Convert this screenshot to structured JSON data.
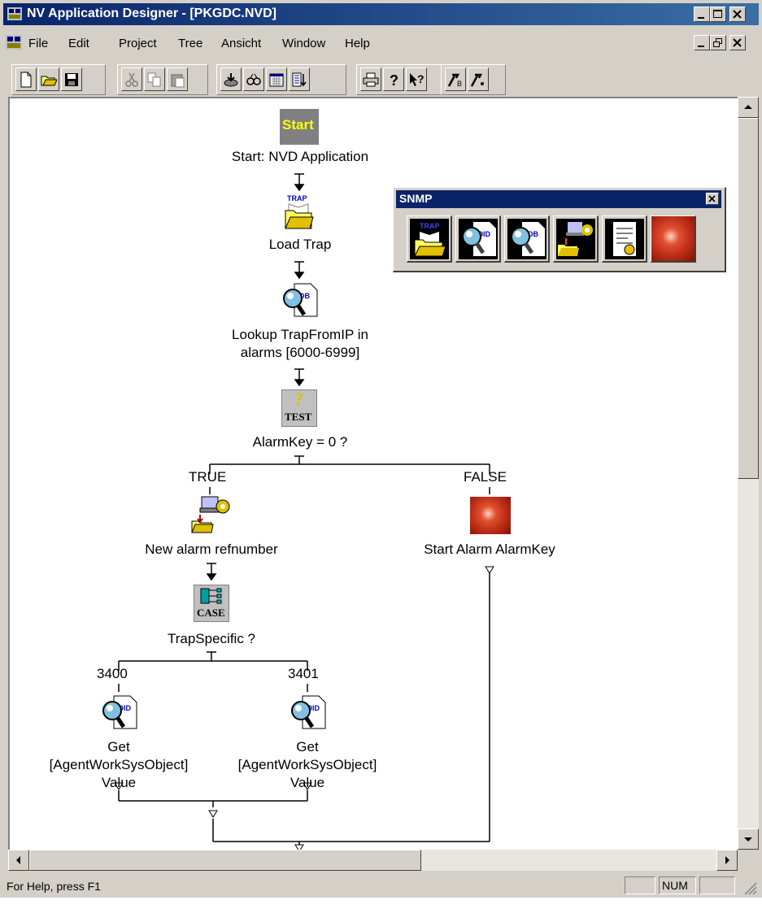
{
  "window": {
    "title": "NV Application Designer - [PKGDC.NVD]"
  },
  "menu": {
    "items": [
      {
        "label": "File"
      },
      {
        "label": "Edit"
      },
      {
        "label": "Project"
      },
      {
        "label": "Tree"
      },
      {
        "label": "Ansicht"
      },
      {
        "label": "Window"
      },
      {
        "label": "Help"
      }
    ]
  },
  "toolbar": {
    "buttons": [
      "new-icon",
      "open-icon",
      "save-icon",
      "cut-icon",
      "copy-icon",
      "paste-icon",
      "import-icon",
      "find-icon",
      "calendar-icon",
      "sort-icon",
      "print-icon",
      "help-icon",
      "context-help-icon",
      "build-icon",
      "hammer-icon"
    ]
  },
  "snmp_palette": {
    "title": "SNMP",
    "tools": [
      "load-trap-icon",
      "lookup-oid-icon",
      "lookup-db-icon",
      "new-refnumber-icon",
      "report-icon",
      "start-alarm-icon"
    ]
  },
  "flow": {
    "start": {
      "icon_text": "Start",
      "label": "Start: NVD Application"
    },
    "load_trap": {
      "icon_text": "TRAP",
      "label": "Load Trap"
    },
    "lookup": {
      "label_line1": "Lookup TrapFromIP in",
      "label_line2": "alarms [6000-6999]"
    },
    "test": {
      "icon_text": "TEST",
      "label": "AlarmKey = 0 ?"
    },
    "branch_true": "TRUE",
    "branch_false": "FALSE",
    "new_alarm": {
      "label": "New alarm refnumber"
    },
    "start_alarm": {
      "label": "Start Alarm AlarmKey"
    },
    "case": {
      "icon_text": "CASE",
      "label": "TrapSpecific ?"
    },
    "case_3400": "3400",
    "case_3401": "3401",
    "get_left": {
      "line1": "Get",
      "line2": "[AgentWorkSysObject]",
      "line3": "Value"
    },
    "get_right": {
      "line1": "Get",
      "line2": "[AgentWorkSysObject]",
      "line3": "Value"
    }
  },
  "status": {
    "help_text": "For Help, press F1",
    "num": "NUM"
  },
  "colors": {
    "title_bar": "#0a246a",
    "face": "#d4d0c8",
    "alarm_red": "#c0301a",
    "start_gray": "#808080"
  }
}
